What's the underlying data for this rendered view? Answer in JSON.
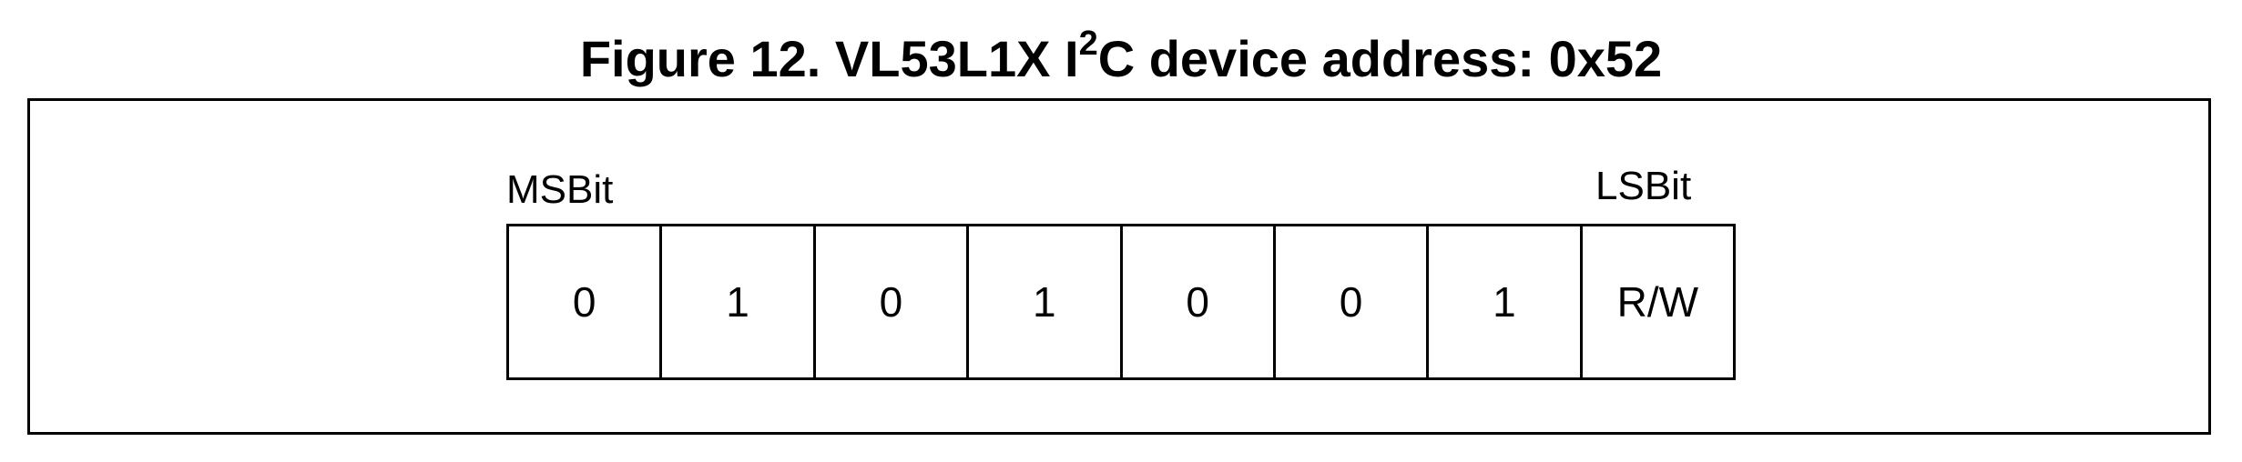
{
  "figure": {
    "title_prefix": "Figure 12. VL53L1X I",
    "title_sup": "2",
    "title_suffix": "C device address: 0x52"
  },
  "register": {
    "msb_label": "MSBit",
    "lsb_label": "LSBit",
    "bits": [
      "0",
      "1",
      "0",
      "1",
      "0",
      "0",
      "1",
      "R/W"
    ]
  }
}
